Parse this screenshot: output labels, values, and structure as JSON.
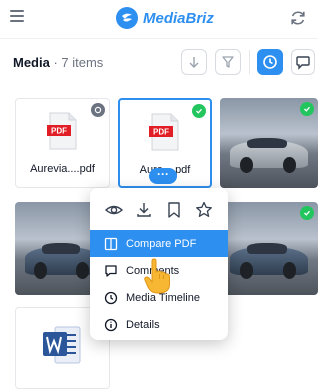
{
  "header": {
    "brand": "MediaBriz"
  },
  "toolbar": {
    "title": "Media",
    "separator": " · ",
    "count": "7 items"
  },
  "files": [
    {
      "name": "Aurevia....pdf",
      "type": "pdf"
    },
    {
      "name": "Aure....pdf",
      "type": "pdf"
    }
  ],
  "more_label": "···",
  "context_menu": {
    "items": [
      {
        "label": "Compare PDF",
        "icon": "compare-icon"
      },
      {
        "label": "Comments",
        "icon": "comment-icon"
      },
      {
        "label": "Media Timeline",
        "icon": "clock-icon"
      },
      {
        "label": "Details",
        "icon": "info-icon"
      }
    ]
  },
  "colors": {
    "accent": "#2d8ff0",
    "success": "#22c55e",
    "pdf": "#e11d25",
    "word": "#2b579a"
  }
}
